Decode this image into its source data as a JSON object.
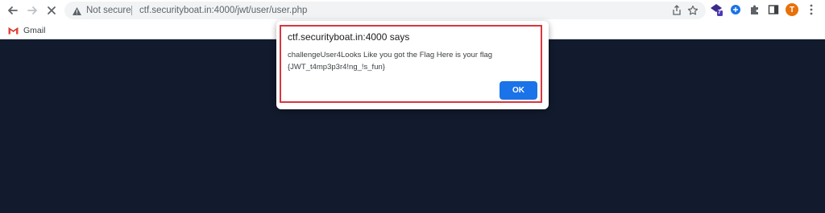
{
  "browser": {
    "security_label": "Not secure",
    "url": "ctf.securityboat.in:4000/jwt/user/user.php",
    "profile_initial": "T",
    "extension_badge": "7"
  },
  "bookmarks": [
    {
      "label": "Gmail",
      "icon": "gmail-icon"
    }
  ],
  "dialog": {
    "title": "ctf.securityboat.in:4000 says",
    "message_line1": "challengeUser4Looks Like you got the Flag Here is your flag",
    "message_line2": "{JWT_t4mp3p3r4!ng_!s_fun}",
    "ok_label": "OK"
  },
  "colors": {
    "page_background": "#121a2d",
    "ok_button": "#1a73e8",
    "highlight_border": "#d9363e",
    "avatar": "#e8710a"
  }
}
